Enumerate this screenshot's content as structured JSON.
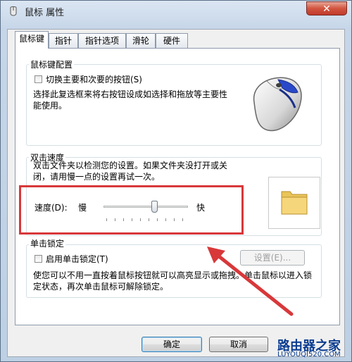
{
  "window": {
    "title": "鼠标 属性",
    "close_glyph": "✕"
  },
  "tabs": [
    {
      "label": "鼠标键",
      "active": true
    },
    {
      "label": "指针",
      "active": false
    },
    {
      "label": "指针选项",
      "active": false
    },
    {
      "label": "滑轮",
      "active": false
    },
    {
      "label": "硬件",
      "active": false
    }
  ],
  "button_config": {
    "group_title": "鼠标键配置",
    "switch_checkbox_label": "切换主要和次要的按钮(S)",
    "switch_checked": false,
    "description": "选择此复选框来将右按钮设成如选择和拖放等主要性能使用。",
    "image_icon": "mouse-icon"
  },
  "double_click": {
    "group_title": "双击速度",
    "description": "双击文件夹以检测您的设置。如果文件夹没打开或关闭，请用慢一点的设置再试一次。",
    "speed_label": "速度(D):",
    "slow_label": "慢",
    "fast_label": "快",
    "speed_level_fraction": 0.6,
    "test_icon": "folder-icon"
  },
  "click_lock": {
    "group_title": "单击锁定",
    "enable_checkbox_label": "启用单击锁定(T)",
    "enable_checked": false,
    "settings_button": "设置(E)...",
    "description": "使您可以不用一直按着鼠标按钮就可以高亮显示或拖拽。单击鼠标以进入锁定状态，再次单击鼠标可解除锁定。"
  },
  "footer": {
    "ok_button": "确定",
    "cancel_button": "取消"
  },
  "annotation": {
    "highlight_color": "#d8383a"
  },
  "watermark": {
    "brand": "路由器之家",
    "url": "LUYOUQI520.COM"
  }
}
